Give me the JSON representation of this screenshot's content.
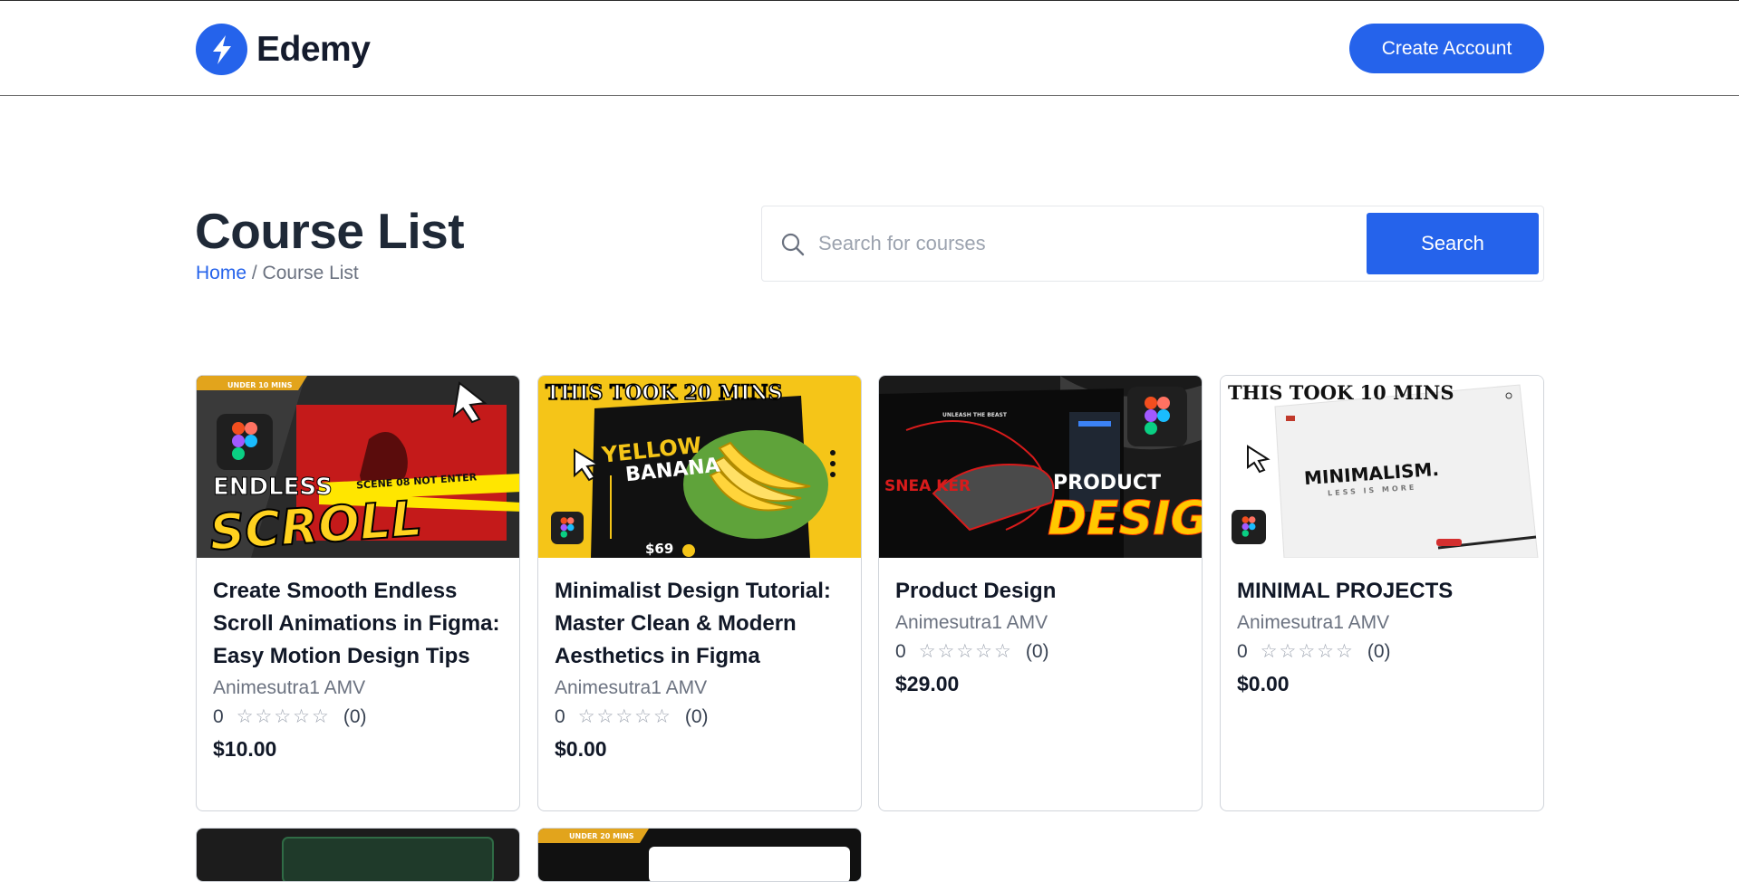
{
  "header": {
    "brand": "Edemy",
    "create_account_label": "Create Account"
  },
  "page": {
    "title": "Course List",
    "breadcrumb_home": "Home",
    "breadcrumb_separator": " / ",
    "breadcrumb_current": "Course List"
  },
  "search": {
    "placeholder": "Search for courses",
    "button_label": "Search"
  },
  "courses": [
    {
      "title": "Create Smooth Endless Scroll Animations in Figma: Easy Motion Design Tips",
      "author": "Animesutra1 AMV",
      "rating": "0",
      "stars": "☆☆☆☆☆",
      "reviews": "(0)",
      "price": "$10.00",
      "thumb": {
        "tag": "UNDER 10 MINS",
        "line1": "ENDLESS",
        "line2": "SCROLL",
        "tape": "SCENE 08 NOT ENTER"
      }
    },
    {
      "title": "Minimalist Design Tutorial: Master Clean & Modern Aesthetics in Figma",
      "author": "Animesutra1 AMV",
      "rating": "0",
      "stars": "☆☆☆☆☆",
      "reviews": "(0)",
      "price": "$0.00",
      "thumb": {
        "headline": "THIS TOOK 20 MINS",
        "line1": "YELLOW",
        "line2": "BANANA",
        "price_tag": "$69"
      }
    },
    {
      "title": "Product Design",
      "author": "Animesutra1 AMV",
      "rating": "0",
      "stars": "☆☆☆☆☆",
      "reviews": "(0)",
      "price": "$29.00",
      "thumb": {
        "line1": "PRODUCT",
        "line2": "DESIGN",
        "side": "SNEA KER",
        "top": "UNLEASH THE BEAST"
      }
    },
    {
      "title": "MINIMAL PROJECTS",
      "author": "Animesutra1 AMV",
      "rating": "0",
      "stars": "☆☆☆☆☆",
      "reviews": "(0)",
      "price": "$0.00",
      "thumb": {
        "headline": "THIS TOOK 10 MINS",
        "word": "MINIMALISM.",
        "sub": "LESS IS MORE"
      }
    }
  ],
  "partial_cards": [
    {
      "tag": "UNDER 20 MINS"
    }
  ],
  "colors": {
    "accent": "#2563eb",
    "figma_red": "#f24e1e",
    "figma_purple": "#a259ff",
    "figma_blue": "#1abcfe",
    "figma_green": "#0acf83"
  },
  "icons": {
    "logo": "lightning-bolt-icon",
    "search": "search-icon",
    "figma": "figma-icon"
  }
}
